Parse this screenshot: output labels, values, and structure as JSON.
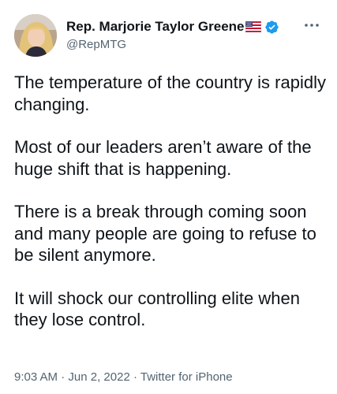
{
  "author": {
    "display_name": "Rep. Marjorie Taylor Greene",
    "handle": "@RepMTG",
    "flag_icon": "us-flag-icon",
    "verified_icon": "verified-badge-icon",
    "verified_color": "#1d9bf0"
  },
  "more_icon": "more-options-icon",
  "tweet": {
    "paragraphs": [
      "The temperature of the country is rapidly changing.",
      "Most of our leaders aren’t aware of the huge shift that is happening.",
      "There is a break through coming soon and many people are going to refuse to be silent anymore.",
      "It will shock our controlling elite when they lose control."
    ]
  },
  "meta": {
    "time": "9:03 AM",
    "separator": "·",
    "date": "Jun 2, 2022",
    "source": "Twitter for iPhone"
  },
  "colors": {
    "text": "#0f1419",
    "secondary": "#536471",
    "accent": "#1d9bf0"
  }
}
